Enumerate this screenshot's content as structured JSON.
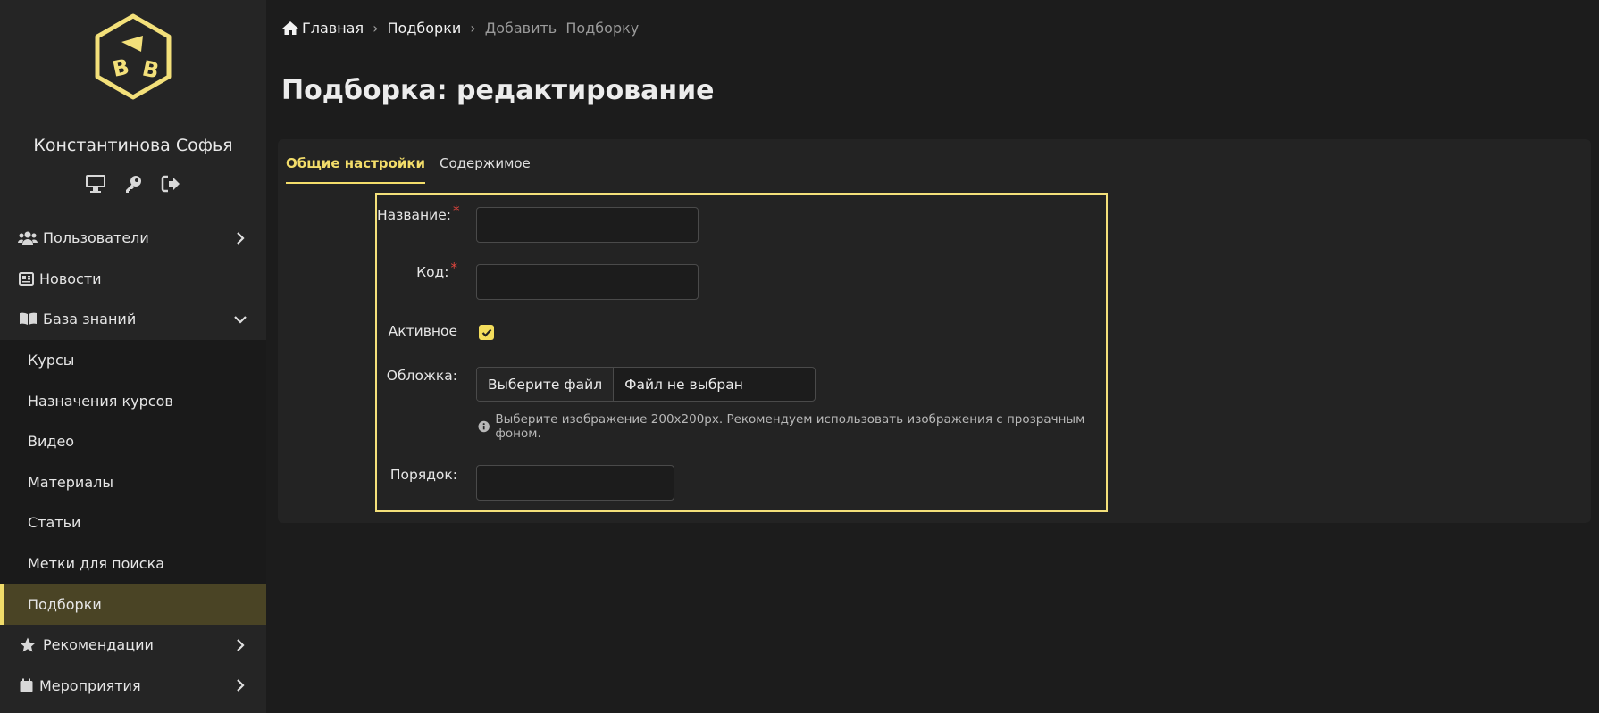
{
  "user": {
    "name": "Константинова Софья"
  },
  "user_actions": [
    "desktop-icon",
    "key-icon",
    "sign-out-icon"
  ],
  "nav": {
    "users": {
      "label": "Пользователи",
      "icon": "users-icon"
    },
    "news": {
      "label": "Новости",
      "icon": "newspaper-icon"
    },
    "knowledge": {
      "label": "База знаний",
      "icon": "book-icon"
    },
    "knowledge_items": [
      {
        "label": "Курсы"
      },
      {
        "label": "Назначения курсов"
      },
      {
        "label": "Видео"
      },
      {
        "label": "Материалы"
      },
      {
        "label": "Статьи"
      },
      {
        "label": "Метки для поиска"
      },
      {
        "label": "Подборки"
      }
    ],
    "recommendations": {
      "label": "Рекомендации",
      "icon": "star-icon"
    },
    "events": {
      "label": "Мероприятия",
      "icon": "calendar-icon"
    }
  },
  "breadcrumb": {
    "home": "Главная",
    "section": "Подборки",
    "current": "Добавить  Подборку"
  },
  "page_title": "Подборка: редактирование",
  "tabs": {
    "general": "Общие настройки",
    "content": "Содержимое"
  },
  "form": {
    "name_label": "Название:",
    "name_value": "",
    "code_label": "Код:",
    "code_value": "",
    "required_mark": "*",
    "active_label": "Активное",
    "active_checked": true,
    "cover_label": "Обложка:",
    "file_button": "Выберите файл",
    "file_status": "Файл не выбран",
    "cover_hint": "Выберите изображение 200x200px. Рекомендуем использовать изображения с прозрачным фоном.",
    "order_label": "Порядок:",
    "order_value": ""
  },
  "colors": {
    "accent": "#f3dd6a",
    "background": "#1c1c1c",
    "sidebar": "#252525",
    "required": "#e0463e"
  }
}
